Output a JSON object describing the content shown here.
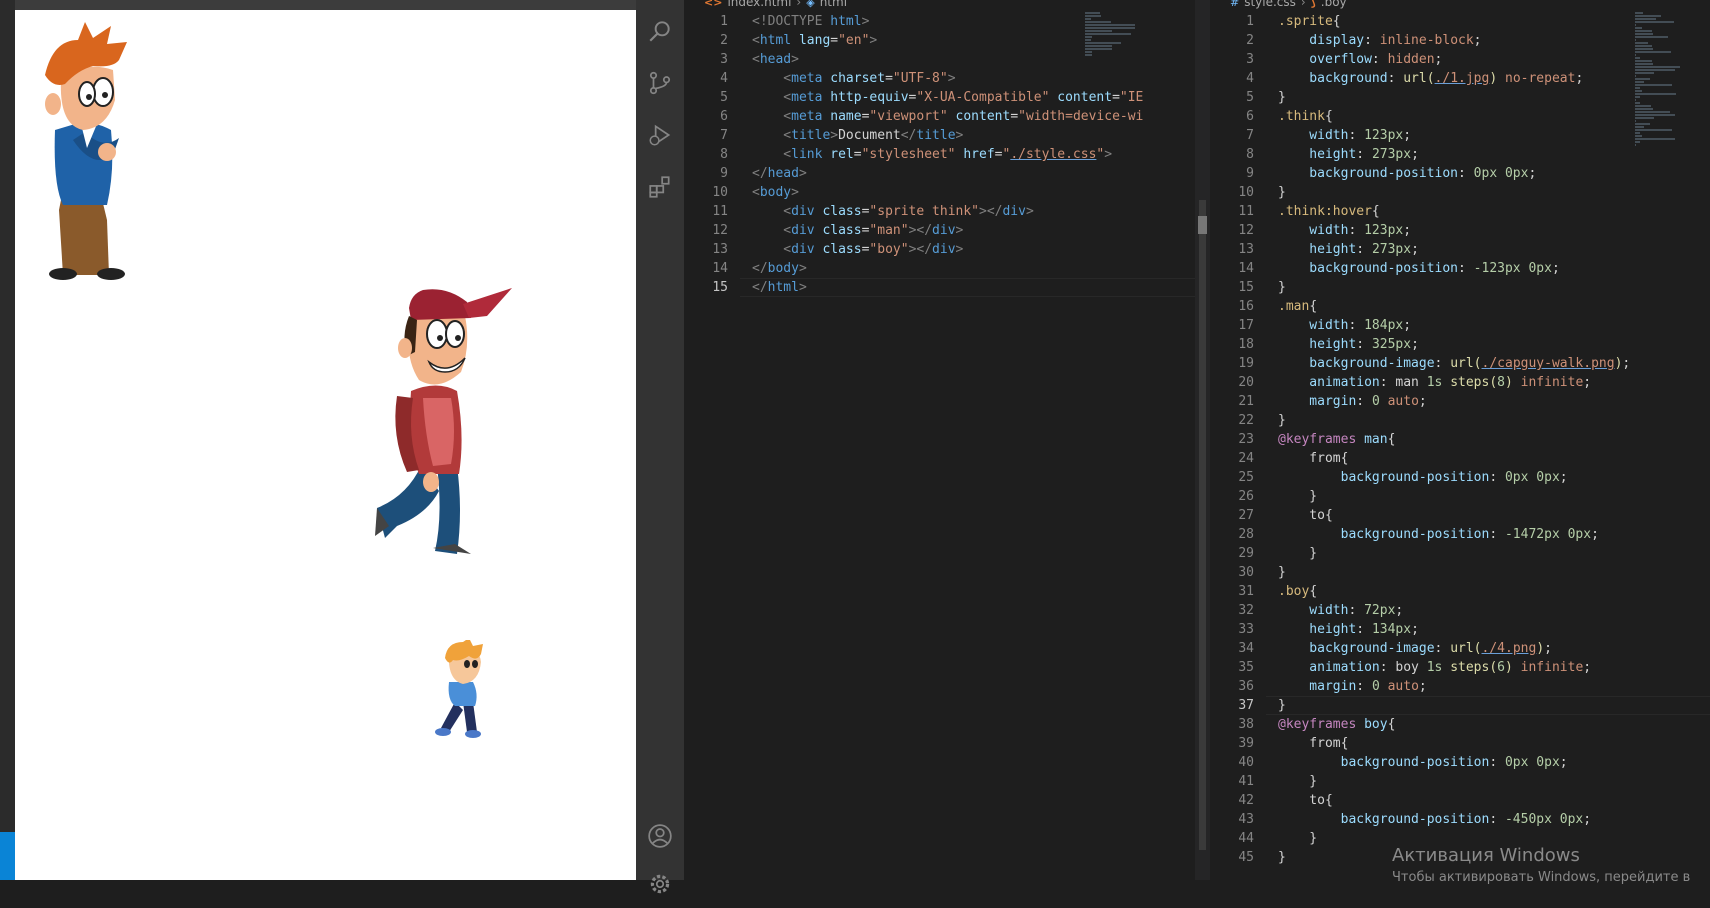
{
  "preview": {
    "sprites": [
      {
        "name": "think-sprite",
        "description": "cartoon man thinking, orange hair, blue sweater"
      },
      {
        "name": "man-sprite",
        "description": "walking man with red cap"
      },
      {
        "name": "boy-sprite",
        "description": "small walking boy, blond hair"
      }
    ]
  },
  "activity_bar": {
    "icons": [
      "search-icon",
      "source-control-icon",
      "run-debug-icon",
      "extensions-icon",
      "account-icon",
      "settings-icon"
    ]
  },
  "editor_left": {
    "breadcrumb": {
      "file": "index.html",
      "symbol": "html"
    },
    "current_line": 15,
    "lines": [
      [
        [
          "<!DOCTYPE ",
          "t-punc"
        ],
        [
          "html",
          "t-doc"
        ],
        [
          ">",
          "t-punc"
        ]
      ],
      [
        [
          "<",
          "t-punc"
        ],
        [
          "html",
          "t-tag"
        ],
        [
          " lang",
          "t-attr"
        ],
        [
          "=",
          "t-text"
        ],
        [
          "\"en\"",
          "t-str"
        ],
        [
          ">",
          "t-punc"
        ]
      ],
      [
        [
          "<",
          "t-punc"
        ],
        [
          "head",
          "t-tag"
        ],
        [
          ">",
          "t-punc"
        ]
      ],
      [
        [
          "    <",
          "t-punc"
        ],
        [
          "meta",
          "t-tag"
        ],
        [
          " charset",
          "t-attr"
        ],
        [
          "=",
          "t-text"
        ],
        [
          "\"UTF-8\"",
          "t-str"
        ],
        [
          ">",
          "t-punc"
        ]
      ],
      [
        [
          "    <",
          "t-punc"
        ],
        [
          "meta",
          "t-tag"
        ],
        [
          " http-equiv",
          "t-attr"
        ],
        [
          "=",
          "t-text"
        ],
        [
          "\"X-UA-Compatible\"",
          "t-str"
        ],
        [
          " content",
          "t-attr"
        ],
        [
          "=",
          "t-text"
        ],
        [
          "\"IE",
          "t-str"
        ]
      ],
      [
        [
          "    <",
          "t-punc"
        ],
        [
          "meta",
          "t-tag"
        ],
        [
          " name",
          "t-attr"
        ],
        [
          "=",
          "t-text"
        ],
        [
          "\"viewport\"",
          "t-str"
        ],
        [
          " content",
          "t-attr"
        ],
        [
          "=",
          "t-text"
        ],
        [
          "\"width=device-wi",
          "t-str"
        ]
      ],
      [
        [
          "    <",
          "t-punc"
        ],
        [
          "title",
          "t-tag"
        ],
        [
          ">",
          "t-punc"
        ],
        [
          "Document",
          "t-text"
        ],
        [
          "</",
          "t-punc"
        ],
        [
          "title",
          "t-tag"
        ],
        [
          ">",
          "t-punc"
        ]
      ],
      [
        [
          "    <",
          "t-punc"
        ],
        [
          "link",
          "t-tag"
        ],
        [
          " rel",
          "t-attr"
        ],
        [
          "=",
          "t-text"
        ],
        [
          "\"stylesheet\"",
          "t-str"
        ],
        [
          " href",
          "t-attr"
        ],
        [
          "=",
          "t-text"
        ],
        [
          "\"",
          "t-str"
        ],
        [
          "./style.css",
          "t-url"
        ],
        [
          "\"",
          "t-str"
        ],
        [
          ">",
          "t-punc"
        ]
      ],
      [
        [
          "</",
          "t-punc"
        ],
        [
          "head",
          "t-tag"
        ],
        [
          ">",
          "t-punc"
        ]
      ],
      [
        [
          "<",
          "t-punc"
        ],
        [
          "body",
          "t-tag"
        ],
        [
          ">",
          "t-punc"
        ]
      ],
      [
        [
          "    <",
          "t-punc"
        ],
        [
          "div",
          "t-tag"
        ],
        [
          " class",
          "t-attr"
        ],
        [
          "=",
          "t-text"
        ],
        [
          "\"sprite think\"",
          "t-str"
        ],
        [
          "></",
          "t-punc"
        ],
        [
          "div",
          "t-tag"
        ],
        [
          ">",
          "t-punc"
        ]
      ],
      [
        [
          "    <",
          "t-punc"
        ],
        [
          "div",
          "t-tag"
        ],
        [
          " class",
          "t-attr"
        ],
        [
          "=",
          "t-text"
        ],
        [
          "\"man\"",
          "t-str"
        ],
        [
          "></",
          "t-punc"
        ],
        [
          "div",
          "t-tag"
        ],
        [
          ">",
          "t-punc"
        ]
      ],
      [
        [
          "    <",
          "t-punc"
        ],
        [
          "div",
          "t-tag"
        ],
        [
          " class",
          "t-attr"
        ],
        [
          "=",
          "t-text"
        ],
        [
          "\"boy\"",
          "t-str"
        ],
        [
          "></",
          "t-punc"
        ],
        [
          "div",
          "t-tag"
        ],
        [
          ">",
          "t-punc"
        ]
      ],
      [
        [
          "</",
          "t-punc"
        ],
        [
          "body",
          "t-tag"
        ],
        [
          ">",
          "t-punc"
        ]
      ],
      [
        [
          "</",
          "t-punc"
        ],
        [
          "html",
          "t-tag"
        ],
        [
          ">",
          "t-punc"
        ]
      ]
    ]
  },
  "editor_right": {
    "breadcrumb": {
      "file": "style.css",
      "symbol": ".boy"
    },
    "current_line": 37,
    "lines": [
      [
        [
          ".sprite",
          "t-sel"
        ],
        [
          "{",
          "t-brace"
        ]
      ],
      [
        [
          "    display",
          "t-prop"
        ],
        [
          ": ",
          "t-text"
        ],
        [
          "inline-block",
          "t-kw"
        ],
        [
          ";",
          "t-text"
        ]
      ],
      [
        [
          "    overflow",
          "t-prop"
        ],
        [
          ": ",
          "t-text"
        ],
        [
          "hidden",
          "t-kw"
        ],
        [
          ";",
          "t-text"
        ]
      ],
      [
        [
          "    background",
          "t-prop"
        ],
        [
          ": ",
          "t-text"
        ],
        [
          "url(",
          "t-fn"
        ],
        [
          "./1.jpg",
          "t-url"
        ],
        [
          ")",
          "t-fn"
        ],
        [
          " no-repeat",
          "t-kw"
        ],
        [
          ";",
          "t-text"
        ]
      ],
      [
        [
          "}",
          "t-brace"
        ]
      ],
      [
        [
          ".think",
          "t-sel"
        ],
        [
          "{",
          "t-brace"
        ]
      ],
      [
        [
          "    width",
          "t-prop"
        ],
        [
          ": ",
          "t-text"
        ],
        [
          "123px",
          "t-num"
        ],
        [
          ";",
          "t-text"
        ]
      ],
      [
        [
          "    height",
          "t-prop"
        ],
        [
          ": ",
          "t-text"
        ],
        [
          "273px",
          "t-num"
        ],
        [
          ";",
          "t-text"
        ]
      ],
      [
        [
          "    background-position",
          "t-prop"
        ],
        [
          ": ",
          "t-text"
        ],
        [
          "0px 0px",
          "t-num"
        ],
        [
          ";",
          "t-text"
        ]
      ],
      [
        [
          "}",
          "t-brace"
        ]
      ],
      [
        [
          ".think:hover",
          "t-sel"
        ],
        [
          "{",
          "t-brace"
        ]
      ],
      [
        [
          "    width",
          "t-prop"
        ],
        [
          ": ",
          "t-text"
        ],
        [
          "123px",
          "t-num"
        ],
        [
          ";",
          "t-text"
        ]
      ],
      [
        [
          "    height",
          "t-prop"
        ],
        [
          ": ",
          "t-text"
        ],
        [
          "273px",
          "t-num"
        ],
        [
          ";",
          "t-text"
        ]
      ],
      [
        [
          "    background-position",
          "t-prop"
        ],
        [
          ": ",
          "t-text"
        ],
        [
          "-123px 0px",
          "t-num"
        ],
        [
          ";",
          "t-text"
        ]
      ],
      [
        [
          "}",
          "t-brace"
        ]
      ],
      [
        [
          ".man",
          "t-sel"
        ],
        [
          "{",
          "t-brace"
        ]
      ],
      [
        [
          "    width",
          "t-prop"
        ],
        [
          ": ",
          "t-text"
        ],
        [
          "184px",
          "t-num"
        ],
        [
          ";",
          "t-text"
        ]
      ],
      [
        [
          "    height",
          "t-prop"
        ],
        [
          ": ",
          "t-text"
        ],
        [
          "325px",
          "t-num"
        ],
        [
          ";",
          "t-text"
        ]
      ],
      [
        [
          "    background-image",
          "t-prop"
        ],
        [
          ": ",
          "t-text"
        ],
        [
          "url(",
          "t-fn"
        ],
        [
          "./capguy-walk.png",
          "t-url"
        ],
        [
          ")",
          "t-fn"
        ],
        [
          ";",
          "t-text"
        ]
      ],
      [
        [
          "    animation",
          "t-prop"
        ],
        [
          ": ",
          "t-text"
        ],
        [
          "man ",
          "t-text"
        ],
        [
          "1s ",
          "t-num"
        ],
        [
          "steps(",
          "t-fn"
        ],
        [
          "8",
          "t-num"
        ],
        [
          ")",
          "t-fn"
        ],
        [
          " infinite",
          "t-kw"
        ],
        [
          ";",
          "t-text"
        ]
      ],
      [
        [
          "    margin",
          "t-prop"
        ],
        [
          ": ",
          "t-text"
        ],
        [
          "0 ",
          "t-num"
        ],
        [
          "auto",
          "t-kw"
        ],
        [
          ";",
          "t-text"
        ]
      ],
      [
        [
          "}",
          "t-brace"
        ]
      ],
      [
        [
          "@keyframes",
          "t-at"
        ],
        [
          " man",
          "t-name"
        ],
        [
          "{",
          "t-brace"
        ]
      ],
      [
        [
          "    from",
          "t-text"
        ],
        [
          "{",
          "t-brace"
        ]
      ],
      [
        [
          "        background-position",
          "t-prop"
        ],
        [
          ": ",
          "t-text"
        ],
        [
          "0px 0px",
          "t-num"
        ],
        [
          ";",
          "t-text"
        ]
      ],
      [
        [
          "    }",
          "t-brace"
        ]
      ],
      [
        [
          "    to",
          "t-text"
        ],
        [
          "{",
          "t-brace"
        ]
      ],
      [
        [
          "        background-position",
          "t-prop"
        ],
        [
          ": ",
          "t-text"
        ],
        [
          "-1472px 0px",
          "t-num"
        ],
        [
          ";",
          "t-text"
        ]
      ],
      [
        [
          "    }",
          "t-brace"
        ]
      ],
      [
        [
          "}",
          "t-brace"
        ]
      ],
      [
        [
          ".boy",
          "t-sel"
        ],
        [
          "{",
          "t-brace"
        ]
      ],
      [
        [
          "    width",
          "t-prop"
        ],
        [
          ": ",
          "t-text"
        ],
        [
          "72px",
          "t-num"
        ],
        [
          ";",
          "t-text"
        ]
      ],
      [
        [
          "    height",
          "t-prop"
        ],
        [
          ": ",
          "t-text"
        ],
        [
          "134px",
          "t-num"
        ],
        [
          ";",
          "t-text"
        ]
      ],
      [
        [
          "    background-image",
          "t-prop"
        ],
        [
          ": ",
          "t-text"
        ],
        [
          "url(",
          "t-fn"
        ],
        [
          "./4.png",
          "t-url"
        ],
        [
          ")",
          "t-fn"
        ],
        [
          ";",
          "t-text"
        ]
      ],
      [
        [
          "    animation",
          "t-prop"
        ],
        [
          ": ",
          "t-text"
        ],
        [
          "boy ",
          "t-text"
        ],
        [
          "1s ",
          "t-num"
        ],
        [
          "steps(",
          "t-fn"
        ],
        [
          "6",
          "t-num"
        ],
        [
          ")",
          "t-fn"
        ],
        [
          " infinite",
          "t-kw"
        ],
        [
          ";",
          "t-text"
        ]
      ],
      [
        [
          "    margin",
          "t-prop"
        ],
        [
          ": ",
          "t-text"
        ],
        [
          "0 ",
          "t-num"
        ],
        [
          "auto",
          "t-kw"
        ],
        [
          ";",
          "t-text"
        ]
      ],
      [
        [
          "}",
          "t-brace"
        ]
      ],
      [
        [
          "@keyframes",
          "t-at"
        ],
        [
          " boy",
          "t-name"
        ],
        [
          "{",
          "t-brace"
        ]
      ],
      [
        [
          "    from",
          "t-text"
        ],
        [
          "{",
          "t-brace"
        ]
      ],
      [
        [
          "        background-position",
          "t-prop"
        ],
        [
          ": ",
          "t-text"
        ],
        [
          "0px 0px",
          "t-num"
        ],
        [
          ";",
          "t-text"
        ]
      ],
      [
        [
          "    }",
          "t-brace"
        ]
      ],
      [
        [
          "    to",
          "t-text"
        ],
        [
          "{",
          "t-brace"
        ]
      ],
      [
        [
          "        background-position",
          "t-prop"
        ],
        [
          ": ",
          "t-text"
        ],
        [
          "-450px 0px",
          "t-num"
        ],
        [
          ";",
          "t-text"
        ]
      ],
      [
        [
          "    }",
          "t-brace"
        ]
      ],
      [
        [
          "}",
          "t-brace"
        ]
      ]
    ]
  },
  "watermark": {
    "title": "Активация Windows",
    "subtitle": "Чтобы активировать Windows, перейдите в"
  }
}
